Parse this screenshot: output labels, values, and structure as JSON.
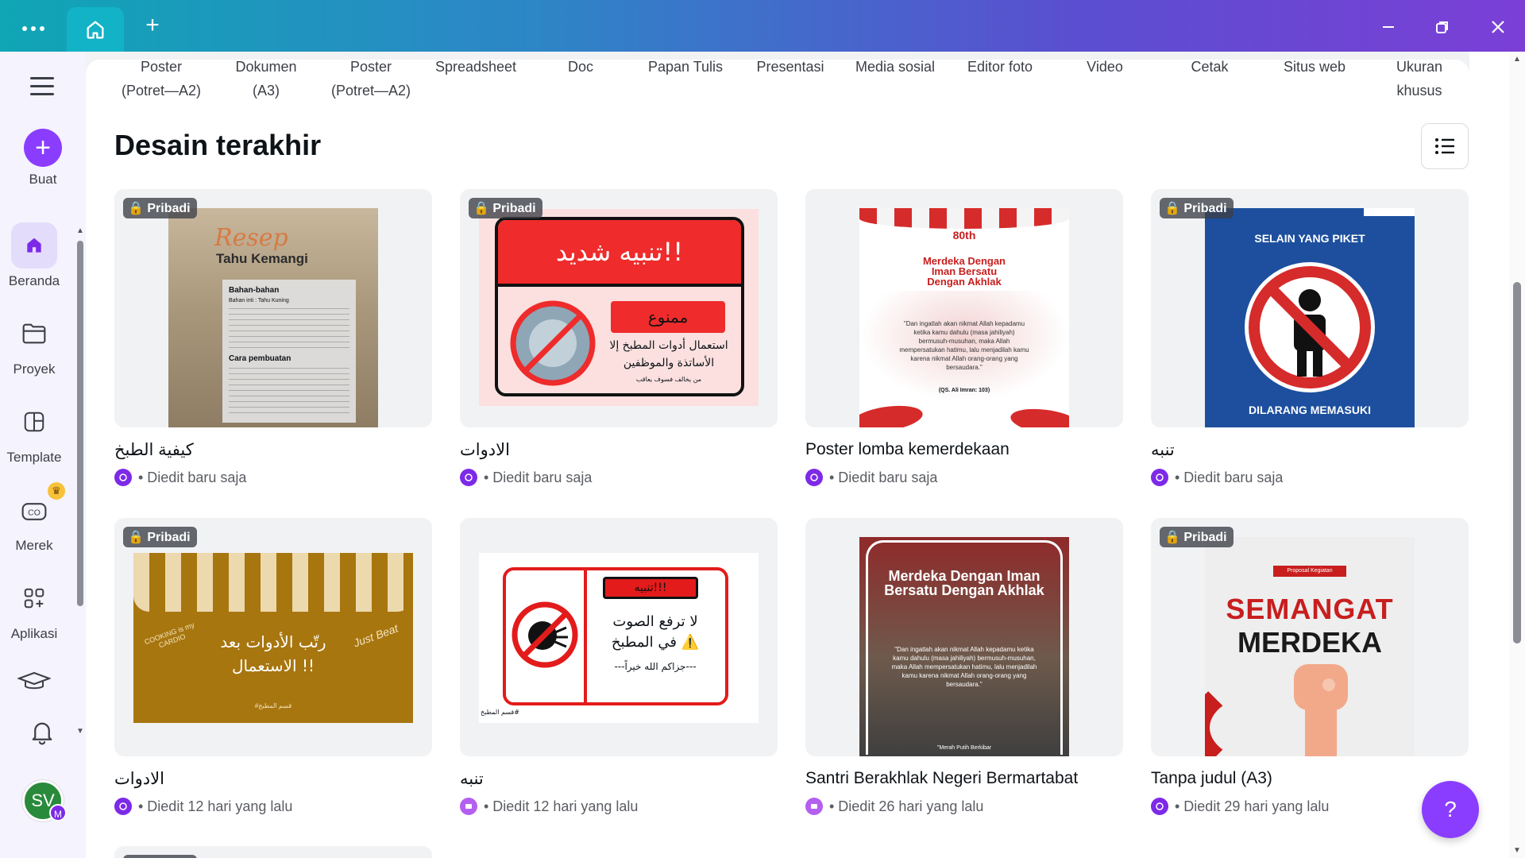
{
  "titlebar": {
    "menu_icon": "more-horizontal-icon",
    "home_icon": "home-icon",
    "new_tab_icon": "plus-icon"
  },
  "rail": {
    "create_label": "Buat",
    "items": [
      {
        "label": "Beranda",
        "icon": "home-icon",
        "active": true
      },
      {
        "label": "Proyek",
        "icon": "folder-icon"
      },
      {
        "label": "Template",
        "icon": "template-icon"
      },
      {
        "label": "Merek",
        "icon": "brand-icon",
        "badge": "crown"
      },
      {
        "label": "Aplikasi",
        "icon": "apps-icon"
      }
    ],
    "avatar_initials": "SV",
    "avatar_sub": "M"
  },
  "categories": [
    {
      "line1": "Poster",
      "line2": "(Potret—A2)"
    },
    {
      "line1": "Dokumen",
      "line2": "(A3)"
    },
    {
      "line1": "Poster",
      "line2": "(Potret—A2)"
    },
    {
      "line1": "Spreadsheet",
      "line2": ""
    },
    {
      "line1": "Doc",
      "line2": ""
    },
    {
      "line1": "Papan Tulis",
      "line2": ""
    },
    {
      "line1": "Presentasi",
      "line2": ""
    },
    {
      "line1": "Media sosial",
      "line2": ""
    },
    {
      "line1": "Editor foto",
      "line2": ""
    },
    {
      "line1": "Video",
      "line2": ""
    },
    {
      "line1": "Cetak",
      "line2": ""
    },
    {
      "line1": "Situs web",
      "line2": ""
    },
    {
      "line1": "Ukuran",
      "line2": "khusus"
    }
  ],
  "section_title": "Desain terakhir",
  "badge_label": "Pribadi",
  "designs": [
    {
      "title": "كيفية الطبخ",
      "meta": "• Diedit baru saja",
      "private": true,
      "preview": {
        "heading": "Resep",
        "subheading": "Tahu Kemangi",
        "ingredients_label": "Bahan-bahan",
        "ingredients_main": "Bahan inti : Tahu Kuning",
        "steps_label": "Cara pembuatan"
      }
    },
    {
      "title": "الادوات",
      "meta": "• Diedit baru saja",
      "private": true,
      "preview": {
        "heading": "تنبيه شديد!!",
        "tag": "ممنوع",
        "line1": "استعمال أدوات المطبخ إلا",
        "line2": "الأساتذة والموظفين",
        "line3": "من يخالف فسوف يعاقب"
      }
    },
    {
      "title": "Poster lomba kemerdekaan",
      "meta": "• Diedit baru saja",
      "private": false,
      "preview": {
        "heading": "Merdeka Dengan Iman Bersatu Dengan Akhlak",
        "badge": "80th",
        "quote": "\"Dan ingatlah akan nikmat Allah kepadamu ketika kamu dahulu (masa jahiliyah) bermusuh-musuhan, maka Allah mempersatukan hatimu, lalu menjadilah kamu karena nikmat Allah orang-orang yang bersaudara.\"",
        "source": "(QS. Ali Imran: 103)"
      }
    },
    {
      "title": "تنبه",
      "meta": "• Diedit baru saja",
      "private": true,
      "preview": {
        "top": "SELAIN YANG PIKET",
        "bottom": "DILARANG MEMASUKI"
      }
    },
    {
      "title": "الادوات",
      "meta": "• Diedit 12 hari yang lalu",
      "private": true,
      "preview": {
        "line1": "رتّب الأدوات بعد",
        "line2": "الاستعمال !!",
        "tag": "#قسم المطبخ",
        "left": "COOKING is my CARDIO",
        "right": "Just Beat"
      }
    },
    {
      "title": "تنبه",
      "meta": "• Diedit 12 hari yang lalu",
      "private": false,
      "preview": {
        "heading": "تنبيه!!!",
        "line1": "لا ترفع الصوت",
        "line2": "في المطبخ ⚠️",
        "line3": "---جزاكم الله خيراً---",
        "tag": "قسم المطبخ#"
      }
    },
    {
      "title": "Santri Berakhlak Negeri Bermartabat",
      "meta": "• Diedit 26 hari yang lalu",
      "private": false,
      "preview": {
        "heading": "Merdeka Dengan Iman Bersatu Dengan Akhlak",
        "quote": "\"Dan ingatlah akan nikmat Allah kepadamu ketika kamu dahulu (masa jahiliyah) bermusuh-musuhan, maka Allah mempersatukan hatimu, lalu menjadilah kamu karena nikmat Allah orang-orang yang bersaudara.\"",
        "footer": "\"Merah Putih Berkibar"
      }
    },
    {
      "title": "Tanpa judul (A3)",
      "meta": "• Diedit 29 hari yang lalu",
      "private": true,
      "preview": {
        "tag": "Proposal Kegiatan",
        "line1": "SEMANGAT",
        "line2": "MERDEKA"
      }
    }
  ],
  "help_label": "?",
  "colors": {
    "accent": "#8b3dff",
    "rail_bg": "#f5f3fd"
  }
}
